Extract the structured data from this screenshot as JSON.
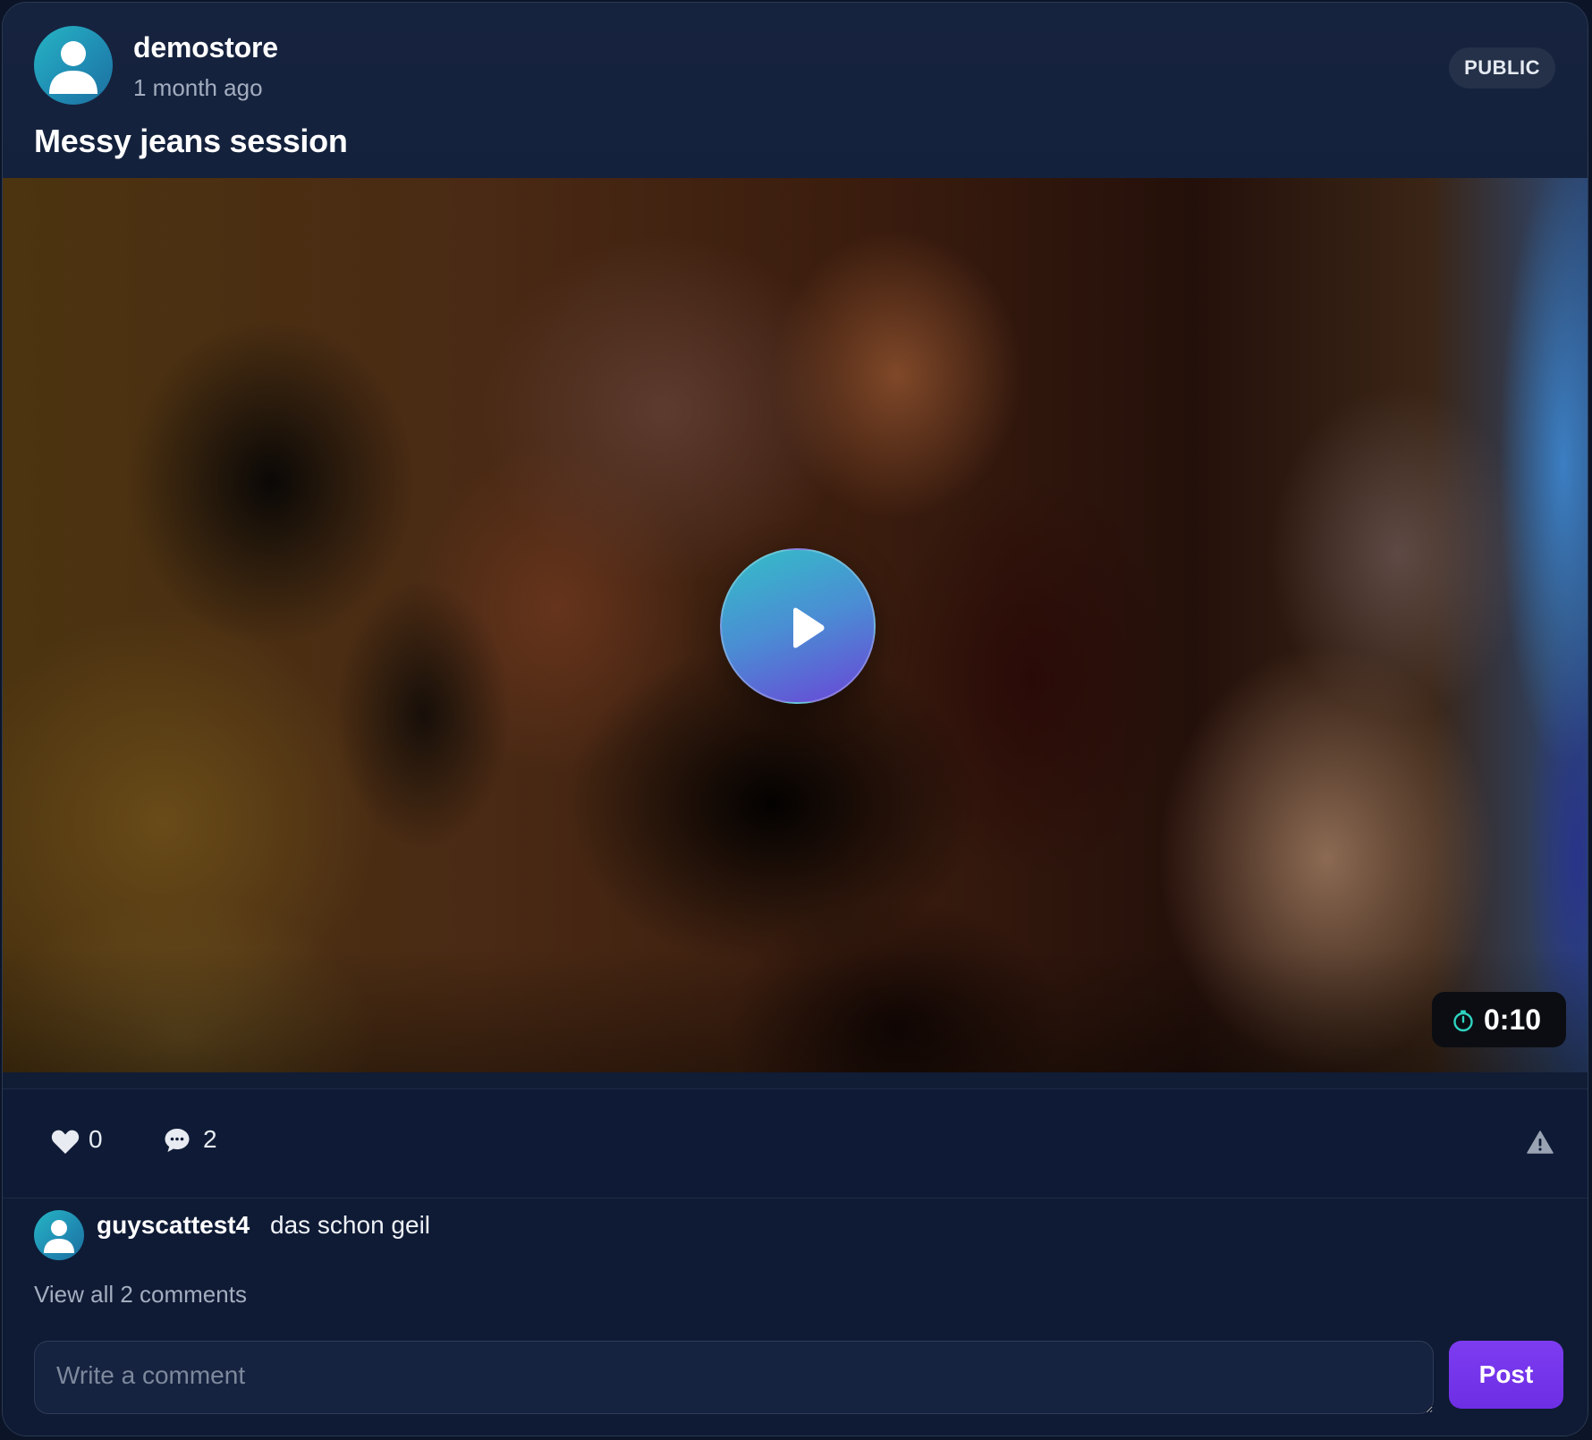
{
  "post": {
    "author": "demostore",
    "timestamp": "1 month ago",
    "visibility": "PUBLIC",
    "title": "Messy jeans session"
  },
  "media": {
    "type": "video",
    "duration": "0:10",
    "play_icon": "play-icon",
    "timer_icon": "timer-icon"
  },
  "actions": {
    "likes": "0",
    "comments": "2",
    "like_icon": "heart-icon",
    "comment_icon": "chat-bubble-icon",
    "report_icon": "warning-triangle-icon"
  },
  "comments": {
    "items": [
      {
        "author": "guyscattest4",
        "text": "das schon geil"
      }
    ],
    "view_all_label": "View all 2 comments",
    "input_placeholder": "Write a comment",
    "post_label": "Post"
  },
  "colors": {
    "accent": "#7133EA",
    "avatar": "#1F8FB6",
    "play_gradient_start": "#33BFC7",
    "play_gradient_end": "#6A45D6",
    "card_background": "#111C35"
  }
}
